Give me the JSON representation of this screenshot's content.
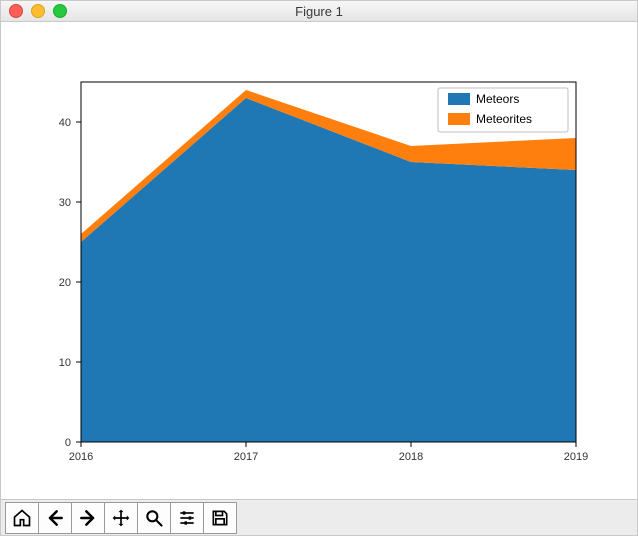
{
  "window": {
    "title": "Figure 1"
  },
  "chart_data": {
    "type": "area",
    "x": [
      2016,
      2017,
      2018,
      2019
    ],
    "series": [
      {
        "name": "Meteors",
        "values": [
          25,
          43,
          35,
          34
        ],
        "color": "#1f77b4"
      },
      {
        "name": "Meteorites",
        "values": [
          1,
          1,
          2,
          4
        ],
        "color": "#ff7f0e"
      }
    ],
    "xlim": [
      2016,
      2019
    ],
    "ylim": [
      0,
      45
    ],
    "xticks": [
      2016,
      2017,
      2018,
      2019
    ],
    "yticks": [
      0,
      10,
      20,
      30,
      40
    ],
    "title": "",
    "xlabel": "",
    "ylabel": "",
    "legend_position": "upper right",
    "grid": false
  },
  "legend": {
    "items": [
      {
        "label": "Meteors"
      },
      {
        "label": "Meteorites"
      }
    ]
  },
  "axes": {
    "xtick_labels": [
      "2016",
      "2017",
      "2018",
      "2019"
    ],
    "ytick_labels": [
      "0",
      "10",
      "20",
      "30",
      "40"
    ]
  },
  "toolbar": {
    "home_label": "Home",
    "back_label": "Back",
    "forward_label": "Forward",
    "pan_label": "Pan",
    "zoom_label": "Zoom",
    "configure_label": "Configure subplots",
    "save_label": "Save"
  }
}
